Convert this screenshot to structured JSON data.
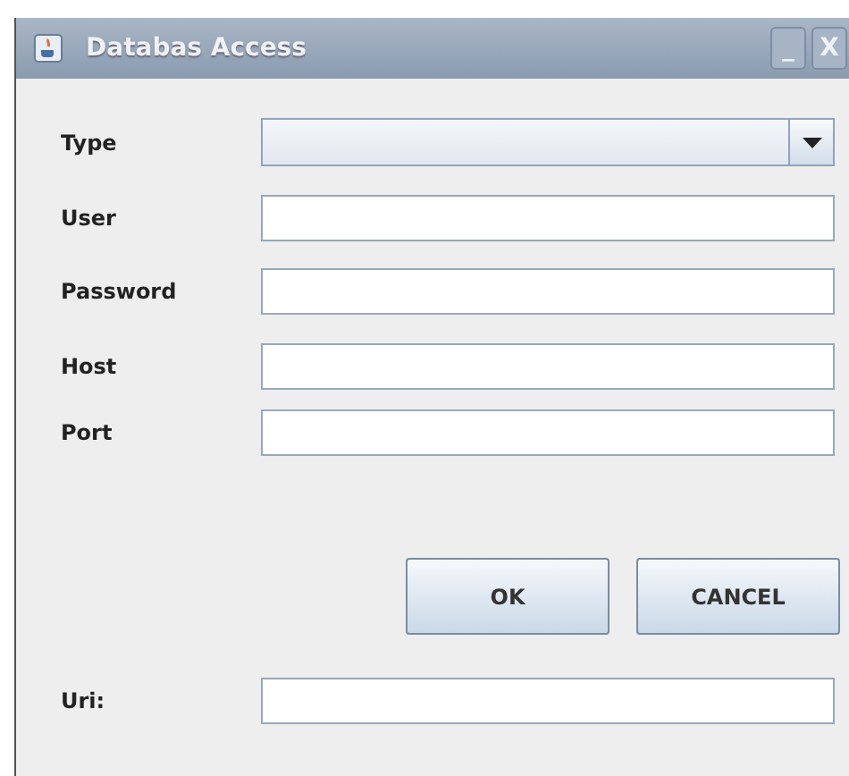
{
  "window": {
    "title": "Databas Access",
    "buttons": [
      "_",
      "X"
    ]
  },
  "fields": [
    {
      "label": "Type",
      "kind": "combo"
    },
    {
      "label": "User",
      "kind": "text"
    },
    {
      "label": "Password",
      "kind": "text"
    },
    {
      "label": "Host",
      "kind": "text"
    },
    {
      "label": "Port",
      "kind": "text"
    }
  ],
  "buttons": [
    "OK",
    "CANCEL"
  ],
  "uri": {
    "label": "Uri:"
  }
}
